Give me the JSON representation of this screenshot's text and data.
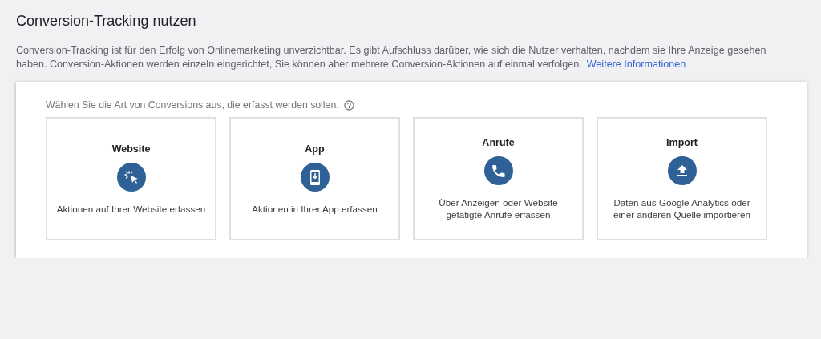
{
  "title": "Conversion-Tracking nutzen",
  "description": "Conversion-Tracking ist für den Erfolg von Onlinemarketing unverzichtbar. Es gibt Aufschluss darüber, wie sich die Nutzer verhalten, nachdem sie Ihre Anzeige gesehen haben. Conversion-Aktionen werden einzeln eingerichtet, Sie können aber mehrere Conversion-Aktionen auf einmal verfolgen.",
  "link": "Weitere Informationen",
  "prompt": "Wählen Sie die Art von Conversions aus, die erfasst werden sollen.",
  "options": [
    {
      "title": "Website",
      "kind": "click",
      "text": "Aktionen auf Ihrer Website erfassen"
    },
    {
      "title": "App",
      "kind": "app",
      "text": "Aktionen in Ihrer App erfassen"
    },
    {
      "title": "Anrufe",
      "kind": "call",
      "text": "Über Anzeigen oder Website getätigte Anrufe erfassen"
    },
    {
      "title": "Import",
      "kind": "upload",
      "text": "Daten aus Google Analytics oder einer anderen Quelle importieren"
    }
  ]
}
